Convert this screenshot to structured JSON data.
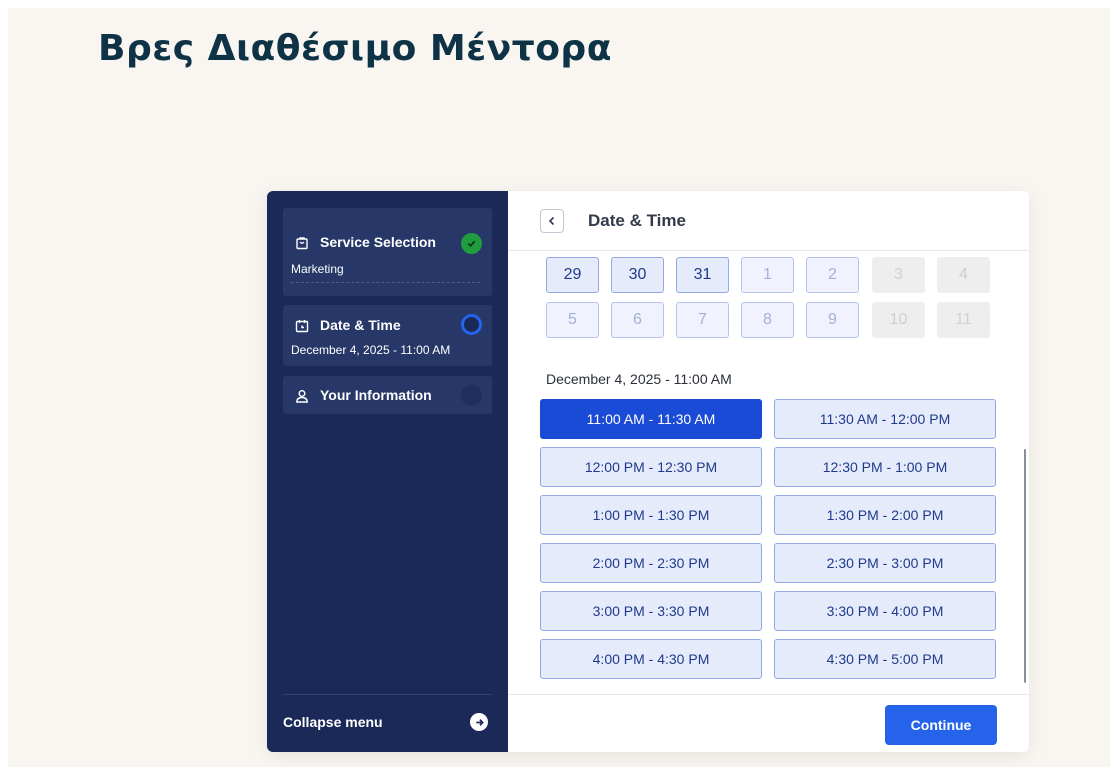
{
  "page": {
    "title": "Βρες Διαθέσιμο Μέντορα"
  },
  "sidebar": {
    "steps": [
      {
        "title": "Service Selection",
        "subtitle": "Marketing",
        "icon": "bag-icon",
        "status": "completed"
      },
      {
        "title": "Date & Time",
        "subtitle": "December 4, 2025 - 11:00 AM",
        "icon": "calendar-icon",
        "status": "active"
      },
      {
        "title": "Your Information",
        "subtitle": "",
        "icon": "user-icon",
        "status": "pending"
      }
    ],
    "collapse_label": "Collapse menu"
  },
  "main": {
    "header_title": "Date & Time",
    "calendar": {
      "weeks": [
        [
          {
            "day": "29",
            "state": "available"
          },
          {
            "day": "30",
            "state": "available"
          },
          {
            "day": "31",
            "state": "available"
          },
          {
            "day": "1",
            "state": "muted"
          },
          {
            "day": "2",
            "state": "muted"
          },
          {
            "day": "3",
            "state": "disabled"
          },
          {
            "day": "4",
            "state": "disabled"
          }
        ],
        [
          {
            "day": "5",
            "state": "muted"
          },
          {
            "day": "6",
            "state": "muted"
          },
          {
            "day": "7",
            "state": "muted"
          },
          {
            "day": "8",
            "state": "muted"
          },
          {
            "day": "9",
            "state": "muted"
          },
          {
            "day": "10",
            "state": "disabled"
          },
          {
            "day": "11",
            "state": "disabled"
          }
        ]
      ]
    },
    "selected_datetime": "December 4, 2025 - 11:00 AM",
    "slots": [
      {
        "label": "11:00 AM - 11:30 AM",
        "selected": true
      },
      {
        "label": "11:30 AM - 12:00 PM",
        "selected": false
      },
      {
        "label": "12:00 PM - 12:30 PM",
        "selected": false
      },
      {
        "label": "12:30 PM - 1:00 PM",
        "selected": false
      },
      {
        "label": "1:00 PM - 1:30 PM",
        "selected": false
      },
      {
        "label": "1:30 PM - 2:00 PM",
        "selected": false
      },
      {
        "label": "2:00 PM - 2:30 PM",
        "selected": false
      },
      {
        "label": "2:30 PM - 3:00 PM",
        "selected": false
      },
      {
        "label": "3:00 PM - 3:30 PM",
        "selected": false
      },
      {
        "label": "3:30 PM - 4:00 PM",
        "selected": false
      },
      {
        "label": "4:00 PM - 4:30 PM",
        "selected": false
      },
      {
        "label": "4:30 PM - 5:00 PM",
        "selected": false
      }
    ],
    "continue_label": "Continue"
  },
  "colors": {
    "sidebar_bg": "#1a2957",
    "accent": "#2563eb",
    "selected_slot": "#1a4bd6",
    "completed": "#1f9d3e",
    "title": "#0f3346"
  }
}
